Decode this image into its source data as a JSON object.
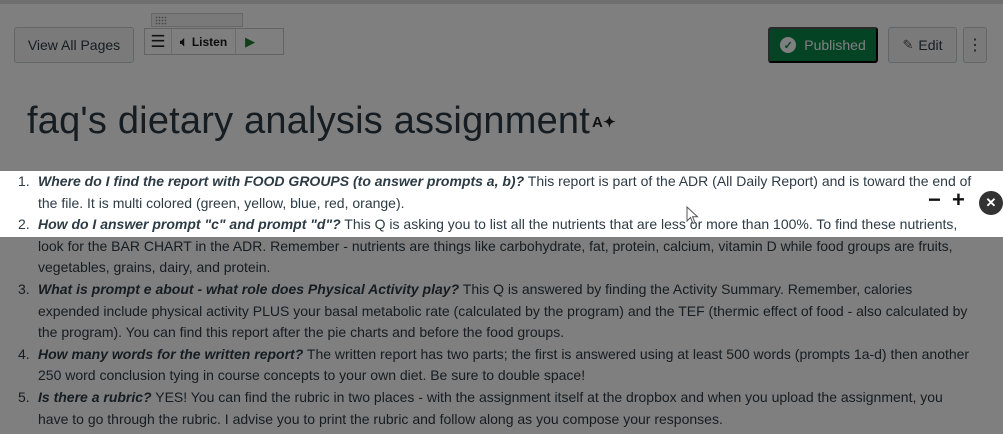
{
  "toolbar": {
    "view_all_pages": "View All Pages",
    "published": "Published",
    "edit": "Edit",
    "more": "⋮"
  },
  "reader": {
    "listen": "Listen",
    "icons": [
      "menu-icon",
      "speaker-icon",
      "play-icon",
      "grip-icon"
    ]
  },
  "page": {
    "title": "faq's dietary analysis assignment"
  },
  "faq": [
    {
      "num": "1.",
      "question": "Where do I find the report with FOOD GROUPS (to answer prompts a, b)?",
      "answer": " This report is part of the ADR (All Daily Report) and is toward the end of the file.  It is multi colored (green, yellow, blue, red, orange)."
    },
    {
      "num": "2.",
      "question": "How do I answer prompt \"c\" and prompt \"d\"?",
      "answer": "  This Q is asking you to list all the nutrients that are less or more than 100%.  To find these nutrients, look for the BAR CHART in the ADR.  Remember - nutrients are things like carbohydrate, fat, protein, calcium, vitamin D while food groups are fruits, vegetables, grains, dairy, and protein."
    },
    {
      "num": "3.",
      "question": "What is prompt e about - what role does Physical Activity play?",
      "answer": "  This Q is answered by finding the Activity Summary.  Remember, calories expended include physical activity PLUS your basal metabolic rate (calculated by the program) and the TEF (thermic effect of food - also calculated by the program).  You can find this report after the pie charts and before the food groups."
    },
    {
      "num": "4.",
      "question": "How many words for the written report?",
      "answer": "  The written report has two parts; the first is answered using at least 500 words (prompts 1a-d) then another 250 word conclusion tying in course concepts to your own diet.  Be sure to double space!"
    },
    {
      "num": "5.",
      "question": "Is there a rubric?",
      "answer": "  YES!  You can find the rubric in two places - with the assignment itself at the dropbox and when you upload the assignment, you have to go through the rubric.  I advise you to print the rubric and follow along as you compose your responses."
    }
  ],
  "controls": {
    "minus": "−",
    "plus": "+",
    "close": "✕"
  },
  "colors": {
    "published_green": "#0b874b",
    "text": "#2d3b45",
    "overlay": "rgba(0,0,0,0.5)"
  }
}
